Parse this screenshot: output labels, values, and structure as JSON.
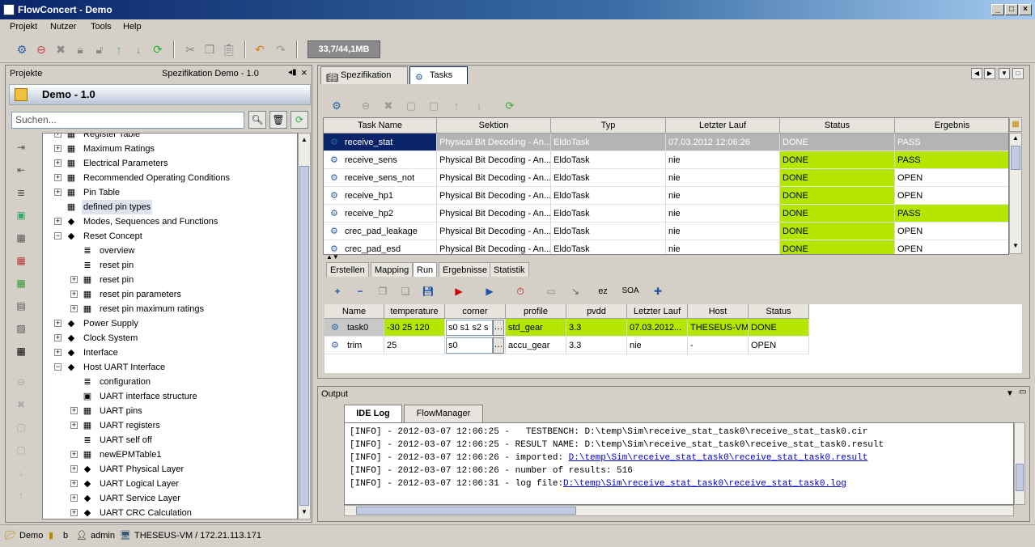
{
  "window": {
    "title": "FlowConcert - Demo"
  },
  "menu": [
    "Projekt",
    "Nutzer",
    "Tools",
    "Help"
  ],
  "toolbar": {
    "memory": "33,7/44,1MB"
  },
  "left": {
    "tabs": [
      "Projekte",
      "Spezifikation Demo - 1.0"
    ],
    "project_title": "Demo - 1.0",
    "search_placeholder": "Suchen...",
    "tree": [
      {
        "label": "Register Table",
        "indent": 1,
        "exp": "+",
        "icon": "table"
      },
      {
        "label": "Maximum Ratings",
        "indent": 1,
        "exp": "+",
        "icon": "table"
      },
      {
        "label": "Electrical Parameters",
        "indent": 1,
        "exp": "+",
        "icon": "table"
      },
      {
        "label": "Recommended Operating Conditions",
        "indent": 1,
        "exp": "+",
        "icon": "table"
      },
      {
        "label": "Pin Table",
        "indent": 1,
        "exp": "+",
        "icon": "table"
      },
      {
        "label": "defined pin types",
        "indent": 1,
        "exp": "",
        "icon": "table",
        "selected": true
      },
      {
        "label": "Modes, Sequences and Functions",
        "indent": 1,
        "exp": "+",
        "icon": "diamond"
      },
      {
        "label": "Reset Concept",
        "indent": 1,
        "exp": "-",
        "icon": "diamond"
      },
      {
        "label": "overview",
        "indent": 2,
        "exp": "",
        "icon": "text"
      },
      {
        "label": "reset pin",
        "indent": 2,
        "exp": "",
        "icon": "text"
      },
      {
        "label": "reset pin",
        "indent": 2,
        "exp": "+",
        "icon": "table"
      },
      {
        "label": "reset pin parameters",
        "indent": 2,
        "exp": "+",
        "icon": "table"
      },
      {
        "label": "reset pin maximum ratings",
        "indent": 2,
        "exp": "+",
        "icon": "table"
      },
      {
        "label": "Power Supply",
        "indent": 1,
        "exp": "+",
        "icon": "diamond"
      },
      {
        "label": "Clock System",
        "indent": 1,
        "exp": "+",
        "icon": "diamond"
      },
      {
        "label": "Interface",
        "indent": 1,
        "exp": "+",
        "icon": "diamond"
      },
      {
        "label": "Host UART Interface",
        "indent": 1,
        "exp": "-",
        "icon": "diamond"
      },
      {
        "label": "configuration",
        "indent": 2,
        "exp": "",
        "icon": "text"
      },
      {
        "label": "UART interface structure",
        "indent": 2,
        "exp": "",
        "icon": "image"
      },
      {
        "label": "UART pins",
        "indent": 2,
        "exp": "+",
        "icon": "table"
      },
      {
        "label": "UART registers",
        "indent": 2,
        "exp": "+",
        "icon": "table"
      },
      {
        "label": "UART self off",
        "indent": 2,
        "exp": "",
        "icon": "text"
      },
      {
        "label": "newEPMTable1",
        "indent": 2,
        "exp": "+",
        "icon": "table"
      },
      {
        "label": "UART Physical Layer",
        "indent": 2,
        "exp": "+",
        "icon": "diamond"
      },
      {
        "label": "UART Logical Layer",
        "indent": 2,
        "exp": "+",
        "icon": "diamond"
      },
      {
        "label": "UART Service Layer",
        "indent": 2,
        "exp": "+",
        "icon": "diamond"
      },
      {
        "label": "UART CRC Calculation",
        "indent": 2,
        "exp": "+",
        "icon": "diamond"
      }
    ]
  },
  "right": {
    "tabs": [
      "Spezifikation",
      "Tasks"
    ],
    "task_columns": [
      "Task Name",
      "Sektion",
      "Typ",
      "Letzter Lauf",
      "Status",
      "Ergebnis"
    ],
    "tasks": [
      {
        "name": "receive_stat",
        "sektion": "Physical Bit Decoding - An...",
        "typ": "EldoTask",
        "lauf": "07.03.2012 12:06:26",
        "status": "DONE",
        "ergebnis": "PASS"
      },
      {
        "name": "receive_sens",
        "sektion": "Physical Bit Decoding - An...",
        "typ": "EldoTask",
        "lauf": "nie",
        "status": "DONE",
        "ergebnis": "PASS"
      },
      {
        "name": "receive_sens_not",
        "sektion": "Physical Bit Decoding - An...",
        "typ": "EldoTask",
        "lauf": "nie",
        "status": "DONE",
        "ergebnis": "OPEN"
      },
      {
        "name": "receive_hp1",
        "sektion": "Physical Bit Decoding - An...",
        "typ": "EldoTask",
        "lauf": "nie",
        "status": "DONE",
        "ergebnis": "OPEN"
      },
      {
        "name": "receive_hp2",
        "sektion": "Physical Bit Decoding - An...",
        "typ": "EldoTask",
        "lauf": "nie",
        "status": "DONE",
        "ergebnis": "PASS"
      },
      {
        "name": "crec_pad_leakage",
        "sektion": "Physical Bit Decoding - An...",
        "typ": "EldoTask",
        "lauf": "nie",
        "status": "DONE",
        "ergebnis": "OPEN"
      },
      {
        "name": "crec_pad_esd",
        "sektion": "Physical Bit Decoding - An...",
        "typ": "EldoTask",
        "lauf": "nie",
        "status": "DONE",
        "ergebnis": "OPEN"
      }
    ],
    "subtabs": [
      "Erstellen",
      "Mapping",
      "Run",
      "Ergebnisse",
      "Statistik"
    ],
    "run_labels": {
      "ez": "ez",
      "soa": "SOA"
    },
    "run_columns": [
      "Name",
      "temperature",
      "corner",
      "profile",
      "pvdd",
      "Letzter Lauf",
      "Host",
      "Status"
    ],
    "runs": [
      {
        "name": "task0",
        "temperature": "-30 25 120",
        "corner": "s0 s1 s2 s",
        "profile": "std_gear",
        "pvdd": "3.3",
        "lauf": "07.03.2012...",
        "host": "THESEUS-VM",
        "status": "DONE"
      },
      {
        "name": "trim",
        "temperature": "25",
        "corner": "s0",
        "profile": "accu_gear",
        "pvdd": "3.3",
        "lauf": "nie",
        "host": "-",
        "status": "OPEN"
      }
    ]
  },
  "output": {
    "title": "Output",
    "tabs": [
      "IDE Log",
      "FlowManager"
    ],
    "lines": [
      {
        "text": "[INFO] - 2012-03-07 12:06:25 -   TESTBENCH: D:\\temp\\Sim\\receive_stat_task0\\receive_stat_task0.cir",
        "link": ""
      },
      {
        "text": "[INFO] - 2012-03-07 12:06:25 - RESULT NAME: D:\\temp\\Sim\\receive_stat_task0\\receive_stat_task0.result",
        "link": ""
      },
      {
        "text": "[INFO] - 2012-03-07 12:06:26 - imported: ",
        "link": "D:\\temp\\Sim\\receive_stat_task0\\receive_stat_task0.result"
      },
      {
        "text": "[INFO] - 2012-03-07 12:06:26 - number of results: 516",
        "link": ""
      },
      {
        "text": "[INFO] - 2012-03-07 12:06:31 - log file:",
        "link": "D:\\temp\\Sim\\receive_stat_task0\\receive_stat_task0.log"
      }
    ]
  },
  "statusbar": {
    "project": "Demo",
    "branch": "b",
    "user": "admin",
    "host": "THESEUS-VM / 172.21.113.171"
  },
  "colors": {
    "done_green": "#b4e600",
    "selection": "#0a246a"
  }
}
